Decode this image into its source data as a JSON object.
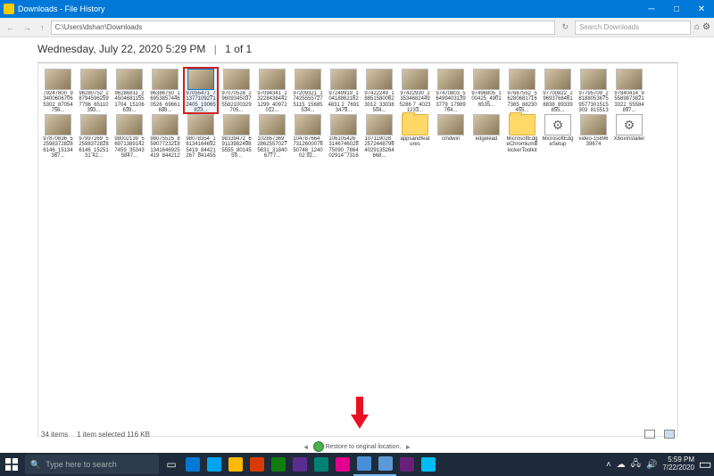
{
  "window": {
    "title": "Downloads - File History",
    "minimize": "─",
    "maximize": "□",
    "close": "✕"
  },
  "toolbar": {
    "back": "←",
    "forward": "→",
    "up": "↑",
    "address": "C:\\Users\\dsharr\\Downloads",
    "refresh": "↻",
    "search_placeholder": "Search Downloads",
    "home_icon": "⌂",
    "gear_icon": "⚙"
  },
  "header": {
    "date": "Wednesday, July 22, 2020 5:29 PM",
    "page": "1 of 1"
  },
  "files_row1": [
    "79247800_934006067065302_87054756...",
    "96280752_287945962597798_65110393...",
    "96286811_245046811551704_15106639...",
    "96386750_169538574460526_69661688...",
    "97055471_713771092712405_19065823...",
    "97070528_296093450375582100329705...",
    "97094341_232284384421299_40972012...",
    "97209321_174255557275115_15685534...",
    "97249919_104188621624831 2_76913479...",
    "97422249_188515800623012_33038504...",
    "97422930_235346824495286 7_40231233...",
    "97470803_564994031393779_17989764...",
    "97496805_100425_49016535...",
    "97687552_562806817167365_88230455...",
    "97700822_296937684618838_89339855...",
    "97795709_281880536759577301515303_81551370...",
    "97840414_955898738213322_55584897...",
    "97870836_525983728286146_15134367...",
    "97997269_525983728286146_1525131 42..."
  ],
  "files_row2": [
    "98002139_569713891427459_353435847...",
    "98075525_859077232181341646925419_84421267_84306730...",
    "98078354_181341646925419_84421267_841455489...",
    "98339472_691139824985555_8014559...",
    "102867369_28625570275631_318406777...",
    "104787664_731260007650746_124002 92...",
    "106105426_314674602875090_786402914_731660820...",
    "107119028_25724487964029135264668...",
    "appsandfeatures",
    "cmdwin",
    "edgelead",
    "MicrosoftEdgeChromiumBlockerToolkit",
    "MicrosoftEdgeSetup",
    "video-1589639674",
    "XboxInstaller"
  ],
  "selected_index": 4,
  "status": {
    "items": "34 items",
    "selected": "1 item selected  116 KB"
  },
  "restore": {
    "prev": "◄",
    "label": "Restore to original location.",
    "next": "►"
  },
  "taskbar": {
    "search_placeholder": "Type here to search",
    "clock_time": "5:59 PM",
    "clock_date": "7/22/2020"
  }
}
